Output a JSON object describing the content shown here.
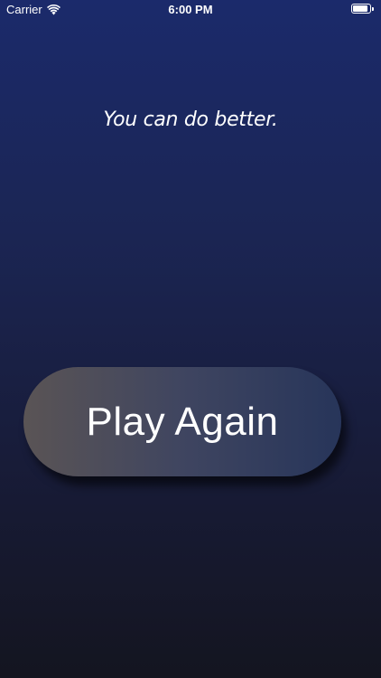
{
  "status_bar": {
    "carrier": "Carrier",
    "time": "6:00 PM",
    "battery_level": 0.9
  },
  "message": "You can do better.",
  "play_again_button": {
    "label": "Play Again"
  },
  "colors": {
    "background_top": "#1b2a6b",
    "background_bottom": "#141520",
    "button_left": "#5a5455",
    "button_right": "#27355a",
    "text": "#ffffff"
  }
}
